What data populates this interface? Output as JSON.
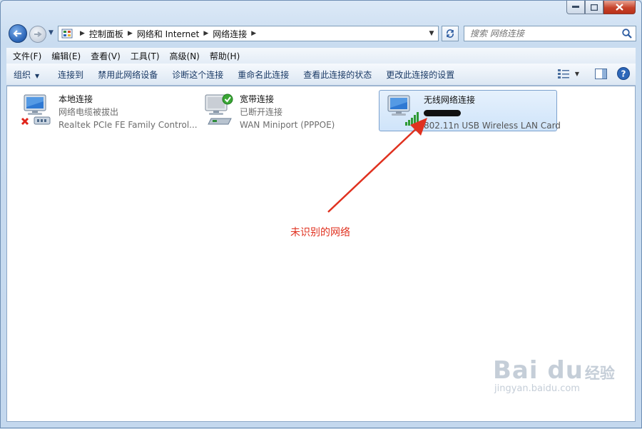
{
  "window": {
    "caption_buttons": {
      "minimize": "▭",
      "maximize": "□",
      "close": "✕"
    }
  },
  "nav": {
    "breadcrumbs": [
      "控制面板",
      "网络和 Internet",
      "网络连接"
    ],
    "search_placeholder": "搜索 网络连接"
  },
  "menu": [
    "文件(F)",
    "编辑(E)",
    "查看(V)",
    "工具(T)",
    "高级(N)",
    "帮助(H)"
  ],
  "commands": {
    "organize": "组织",
    "items": [
      "连接到",
      "禁用此网络设备",
      "诊断这个连接",
      "重命名此连接",
      "查看此连接的状态",
      "更改此连接的设置"
    ]
  },
  "connections": [
    {
      "name": "本地连接",
      "status": "网络电缆被拔出",
      "device": "Realtek PCIe FE Family Control...",
      "icon": "wired-disconnected-icon"
    },
    {
      "name": "宽带连接",
      "status": "已断开连接",
      "device": "WAN Miniport (PPPOE)",
      "icon": "broadband-icon"
    },
    {
      "name": "无线网络连接",
      "status": "",
      "device": "802.11n USB Wireless LAN Card",
      "icon": "wireless-icon",
      "selected": true
    }
  ],
  "annotation": {
    "text": "未识别的网络",
    "color": "#e0311f"
  },
  "watermark": {
    "logo": "Bai du",
    "suffix": "经验",
    "url": "jingyan.baidu.com"
  },
  "colors": {
    "accent": "#2d67b9",
    "selection": "#cfe4fa",
    "annotation": "#e0311f"
  }
}
